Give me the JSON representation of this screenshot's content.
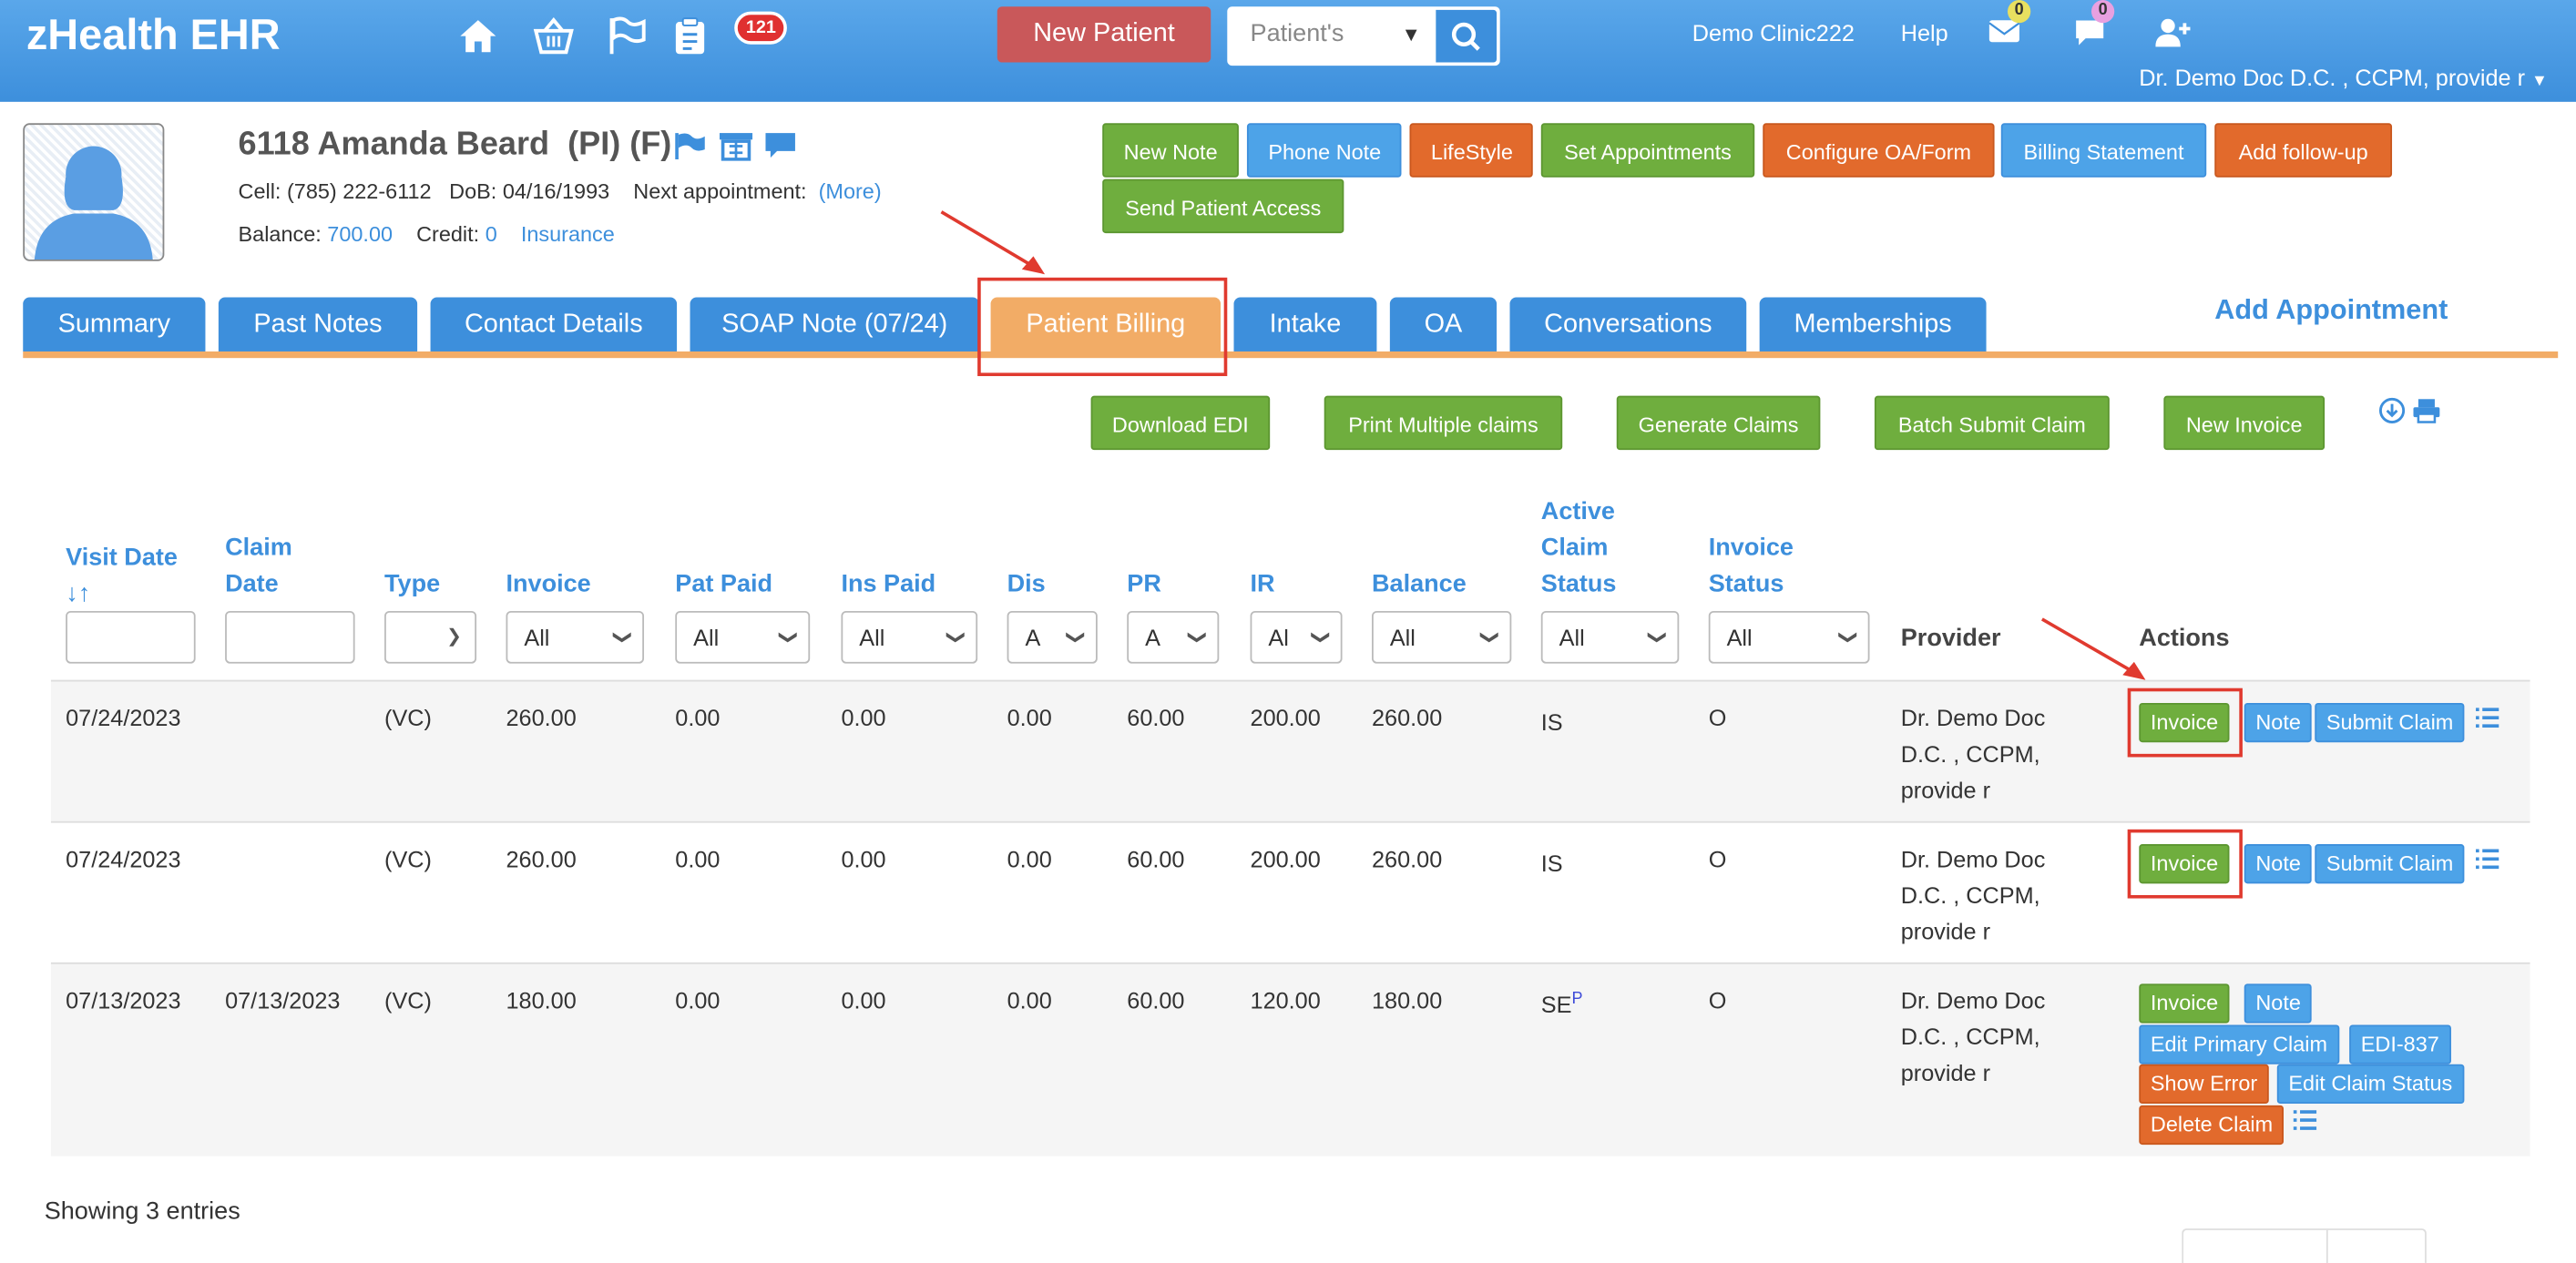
{
  "app": {
    "title": "zHealth EHR",
    "notification_count": "121"
  },
  "topbar": {
    "new_patient": "New Patient",
    "search_select": "Patient's",
    "clinic": "Demo Clinic222",
    "help": "Help",
    "mail_count": "0",
    "chat_count": "0",
    "user": "Dr. Demo Doc D.C. , CCPM, provide r"
  },
  "patient": {
    "name": "6118 Amanda Beard",
    "tags": "(PI) (F)",
    "cell_label": "Cell:",
    "cell": "(785) 222-6112",
    "dob_label": "DoB:",
    "dob": "04/16/1993",
    "next_appt_label": "Next appointment:",
    "more": "(More)",
    "balance_label": "Balance:",
    "balance": "700.00",
    "credit_label": "Credit:",
    "credit": "0",
    "insurance": "Insurance"
  },
  "header_buttons": [
    "New Note",
    "Phone Note",
    "LifeStyle",
    "Set Appointments",
    "Configure OA/Form",
    "Billing Statement",
    "Add follow-up",
    "Send Patient Access"
  ],
  "tabs": [
    "Summary",
    "Past Notes",
    "Contact Details",
    "SOAP Note (07/24)",
    "Patient Billing",
    "Intake",
    "OA",
    "Conversations",
    "Memberships"
  ],
  "add_appointment": "Add Appointment",
  "billing_buttons": [
    "Download EDI",
    "Print Multiple claims",
    "Generate Claims",
    "Batch Submit Claim",
    "New Invoice"
  ],
  "columns": {
    "visit_date": [
      "Visit Date",
      "↓↑"
    ],
    "claim_date": [
      "Claim",
      "Date"
    ],
    "type": "Type",
    "invoice": "Invoice",
    "pat_paid": "Pat Paid",
    "ins_paid": "Ins Paid",
    "dis": "Dis",
    "pr": "PR",
    "ir": "IR",
    "balance": "Balance",
    "active_claim_status": [
      "Active",
      "Claim",
      "Status"
    ],
    "invoice_status": [
      "Invoice",
      "Status"
    ],
    "provider": "Provider",
    "actions": "Actions"
  },
  "filters": {
    "all": "All",
    "a": "A",
    "ai": "Al"
  },
  "rows": [
    {
      "visit_date": "07/24/2023",
      "claim_date": "",
      "type": "(VC)",
      "invoice": "260.00",
      "pat_paid": "0.00",
      "ins_paid": "0.00",
      "dis": "0.00",
      "pr": "60.00",
      "ir": "200.00",
      "balance": "260.00",
      "claim_status": "IS",
      "claim_sup": "",
      "invoice_status": "O",
      "provider": [
        "Dr. Demo Doc",
        "D.C. , CCPM,",
        "provide r"
      ]
    },
    {
      "visit_date": "07/24/2023",
      "claim_date": "",
      "type": "(VC)",
      "invoice": "260.00",
      "pat_paid": "0.00",
      "ins_paid": "0.00",
      "dis": "0.00",
      "pr": "60.00",
      "ir": "200.00",
      "balance": "260.00",
      "claim_status": "IS",
      "claim_sup": "",
      "invoice_status": "O",
      "provider": [
        "Dr. Demo Doc",
        "D.C. , CCPM,",
        "provide r"
      ]
    },
    {
      "visit_date": "07/13/2023",
      "claim_date": "07/13/2023",
      "type": "(VC)",
      "invoice": "180.00",
      "pat_paid": "0.00",
      "ins_paid": "0.00",
      "dis": "0.00",
      "pr": "60.00",
      "ir": "120.00",
      "balance": "180.00",
      "claim_status": "SE",
      "claim_sup": "P",
      "invoice_status": "O",
      "provider": [
        "Dr. Demo Doc",
        "D.C. , CCPM,",
        "provide r"
      ]
    }
  ],
  "row_actions": {
    "invoice": "Invoice",
    "note": "Note",
    "submit_claim": "Submit Claim",
    "edit_primary_claim": "Edit Primary Claim",
    "edi_837": "EDI-837",
    "show_error": "Show Error",
    "edit_claim_status": "Edit Claim Status",
    "delete_claim": "Delete Claim"
  },
  "footer": {
    "showing": "Showing 3 entries"
  },
  "colors": {
    "brand_blue": "#3d8fdc",
    "green": "#6fae3e",
    "orange": "#e26a2c",
    "active_tab": "#f2ac66",
    "highlight_red": "#e03a2f"
  }
}
